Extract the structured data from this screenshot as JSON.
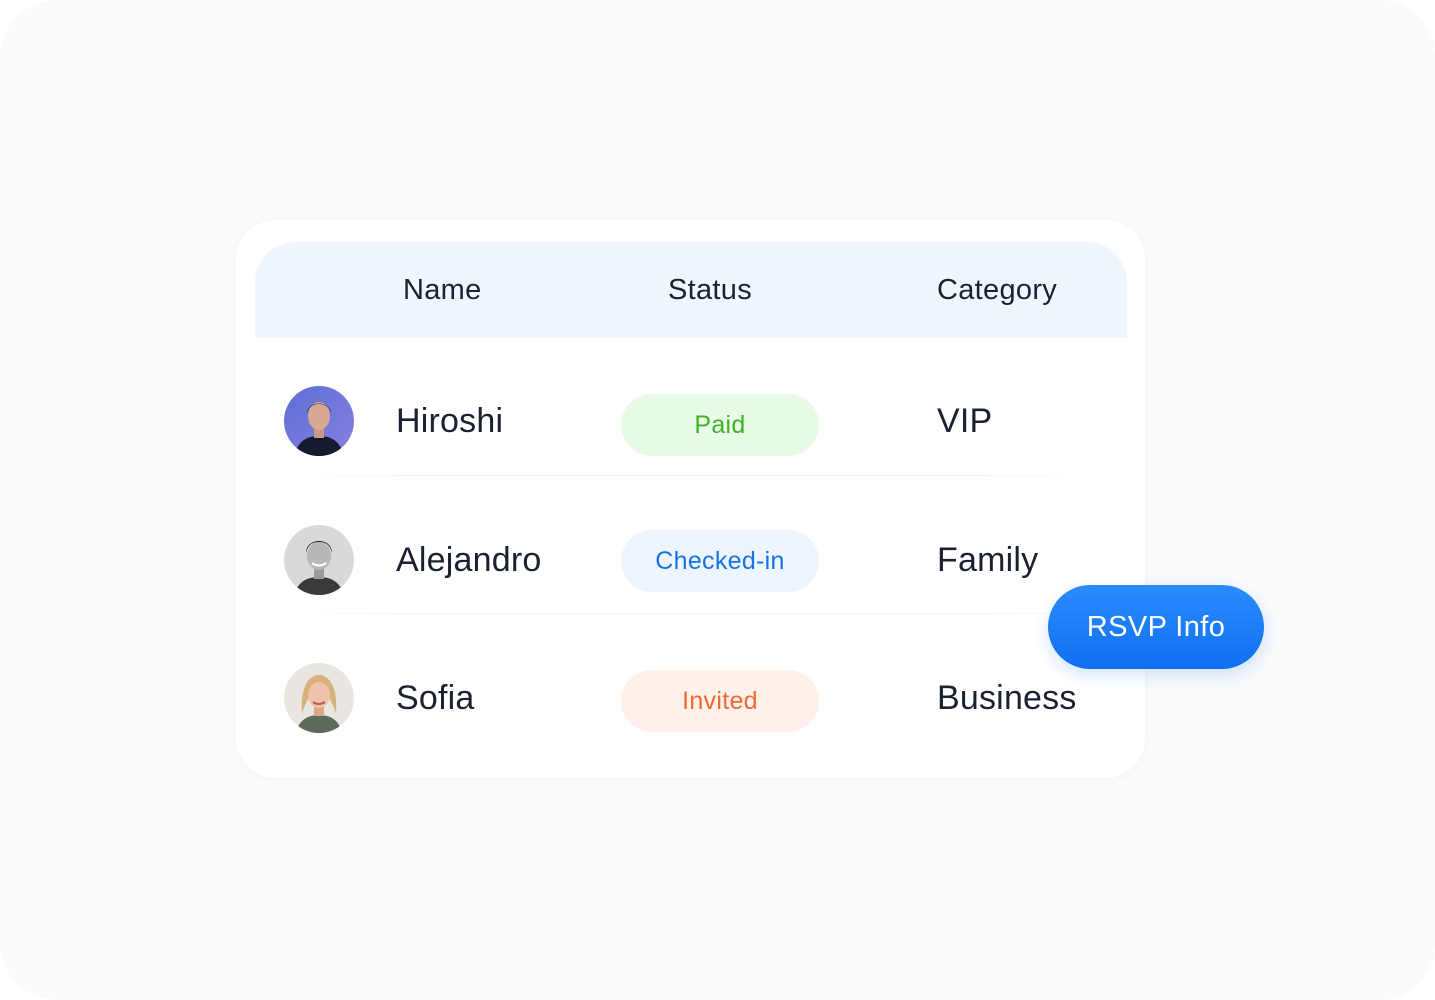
{
  "table": {
    "headers": {
      "name": "Name",
      "status": "Status",
      "category": "Category"
    },
    "rows": [
      {
        "name": "Hiroshi",
        "status": "Paid",
        "status_kind": "paid",
        "category": "VIP",
        "avatar_icon": "person-avatar-icon"
      },
      {
        "name": "Alejandro",
        "status": "Checked-in",
        "status_kind": "checked-in",
        "category": "Family",
        "avatar_icon": "person-avatar-icon"
      },
      {
        "name": "Sofia",
        "status": "Invited",
        "status_kind": "invited",
        "category": "Business",
        "avatar_icon": "person-avatar-icon"
      }
    ]
  },
  "actions": {
    "rsvp_label": "RSVP Info"
  },
  "colors": {
    "accent": "#1673e6",
    "paid_text": "#3fb12a",
    "paid_bg": "#e8fbe7",
    "checked_text": "#1673e6",
    "checked_bg": "#eef5fe",
    "invited_text": "#ee6a36",
    "invited_bg": "#fff1ea",
    "header_bg": "#eff6fe"
  }
}
